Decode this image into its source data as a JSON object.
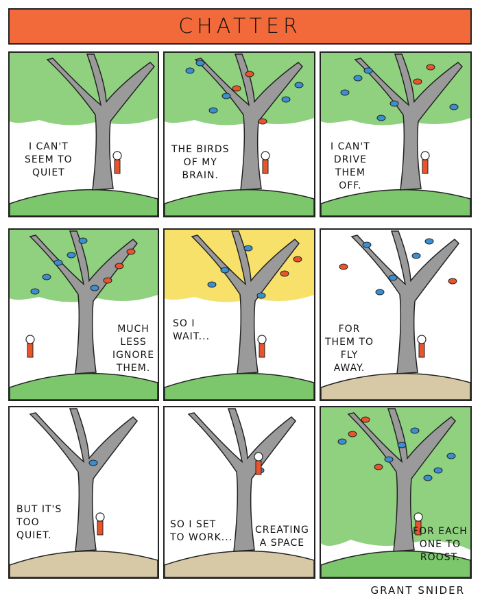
{
  "title": "CHATTER",
  "signature": "GRANT SNIDER",
  "colors": {
    "title_bar": "#f26a3a",
    "canopy_green": "#8fd17e",
    "canopy_yellow": "#f7e16a",
    "ground_green": "#7cc76c",
    "ground_tan": "#d8c9a6",
    "trunk": "#9a9a9a",
    "bird_blue": "#3b8fd0",
    "bird_red": "#e8542c"
  },
  "panels": [
    {
      "caption": [
        "I CAN'T",
        "SEEM TO",
        "QUIET"
      ],
      "canopy": "green",
      "ground": "green",
      "birds": 0
    },
    {
      "caption": [
        "THE BIRDS",
        "OF MY",
        "BRAIN."
      ],
      "canopy": "green",
      "ground": "green",
      "birds": 9
    },
    {
      "caption": [
        "I CAN'T",
        "DRIVE",
        "THEM",
        "OFF."
      ],
      "canopy": "green",
      "ground": "green",
      "birds": 8
    },
    {
      "caption": [
        "MUCH",
        "LESS",
        "IGNORE",
        "THEM."
      ],
      "canopy": "green",
      "ground": "green",
      "birds": 9
    },
    {
      "caption": [
        "SO I",
        "WAIT..."
      ],
      "canopy": "yellow",
      "ground": "green",
      "birds": 6
    },
    {
      "caption": [
        "FOR",
        "THEM TO",
        "FLY",
        "AWAY."
      ],
      "canopy": "none",
      "ground": "tan",
      "birds": 7
    },
    {
      "caption": [
        "BUT IT'S",
        "TOO",
        "QUIET."
      ],
      "canopy": "none",
      "ground": "tan",
      "birds": 1
    },
    {
      "caption": [
        "SO I SET",
        "TO WORK..."
      ],
      "caption2": [
        "CREATING",
        "A SPACE"
      ],
      "canopy": "none",
      "ground": "tan",
      "birds": 1
    },
    {
      "caption": [
        "FOR EACH",
        "ONE TO",
        "ROOST."
      ],
      "canopy": "green",
      "ground": "green",
      "birds": 10
    }
  ]
}
